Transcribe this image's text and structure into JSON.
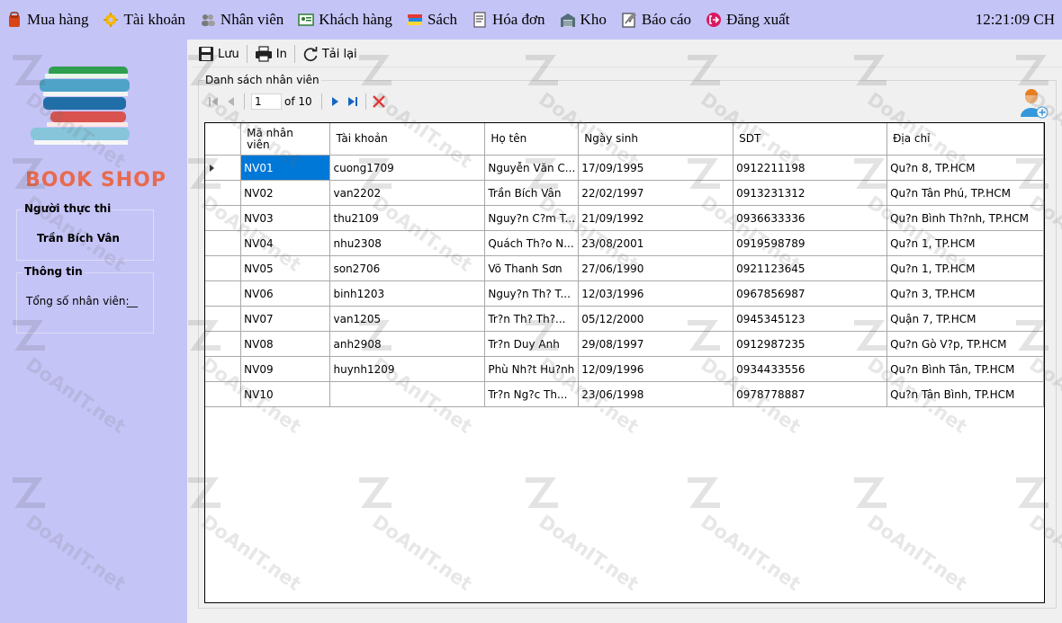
{
  "menu": {
    "items": [
      {
        "label": "Mua hàng",
        "icon": "shopping-bag-icon"
      },
      {
        "label": "Tài khoản",
        "icon": "gear-icon"
      },
      {
        "label": "Nhân viên",
        "icon": "people-icon"
      },
      {
        "label": "Khách hàng",
        "icon": "customer-card-icon"
      },
      {
        "label": "Sách",
        "icon": "books-icon"
      },
      {
        "label": "Hóa đơn",
        "icon": "invoice-icon"
      },
      {
        "label": "Kho",
        "icon": "warehouse-icon"
      },
      {
        "label": "Báo cáo",
        "icon": "report-icon"
      },
      {
        "label": "Đăng xuất",
        "icon": "logout-icon"
      }
    ],
    "clock": "12:21:09 CH"
  },
  "logo": {
    "text": "BOOK SHOP"
  },
  "sidebar": {
    "performer": {
      "title": "Người thực thi",
      "name": "Trần Bích Vân"
    },
    "info": {
      "title": "Thông tin",
      "total_label": "Tổng số nhân viên:",
      "total_value": "__"
    }
  },
  "toolbar": {
    "save": "Lưu",
    "print": "In",
    "reload": "Tải lại"
  },
  "employees": {
    "title": "Danh sách nhân viên",
    "nav": {
      "page": "1",
      "of": "of 10"
    },
    "columns": [
      "Mã nhân\nviên",
      "Tài khoản",
      "Họ tên",
      "Ngày sinh",
      "SDT",
      "Địa chỉ"
    ],
    "rows": [
      [
        "NV01",
        "cuong1709",
        "Nguyễn Văn C...",
        "17/09/1995",
        "0912211198",
        "Qu?n 8, TP.HCM"
      ],
      [
        "NV02",
        "van2202",
        "Trần Bích Vân",
        "22/02/1997",
        "0913231312",
        "Qu?n Tân Phú, TP.HCM"
      ],
      [
        "NV03",
        "thu2109",
        "Nguy?n C?m T...",
        "21/09/1992",
        "0936633336",
        "Qu?n Bình Th?nh, TP.HCM"
      ],
      [
        "NV04",
        "nhu2308",
        "Quách Th?o N...",
        "23/08/2001",
        "0919598789",
        "Qu?n 1, TP.HCM"
      ],
      [
        "NV05",
        "son2706",
        "Võ Thanh Sơn",
        "27/06/1990",
        "0921123645",
        "Qu?n 1, TP.HCM"
      ],
      [
        "NV06",
        "binh1203",
        "Nguy?n Th? T...",
        "12/03/1996",
        "0967856987",
        "Qu?n 3, TP.HCM"
      ],
      [
        "NV07",
        "van1205",
        "Tr?n Th? Th?...",
        "05/12/2000",
        "0945345123",
        "Quận 7, TP.HCM"
      ],
      [
        "NV08",
        "anh2908",
        "Tr?n Duy Anh",
        "29/08/1997",
        "0912987235",
        "Qu?n Gò V?p, TP.HCM"
      ],
      [
        "NV09",
        "huynh1209",
        "Phù Nh?t Hu?nh",
        "12/09/1996",
        "0934433556",
        "Qu?n Bình Tân, TP.HCM"
      ],
      [
        "NV10",
        "",
        "Tr?n Ng?c Th...",
        "23/06/1998",
        "0978778887",
        "Qu?n Tân Bình, TP.HCM"
      ]
    ]
  },
  "watermark": {
    "text": "DoAnIT.net"
  },
  "colors": {
    "menu_bg": "#c5c4f7",
    "selection": "#0078d7",
    "delete_red": "#e53935"
  }
}
